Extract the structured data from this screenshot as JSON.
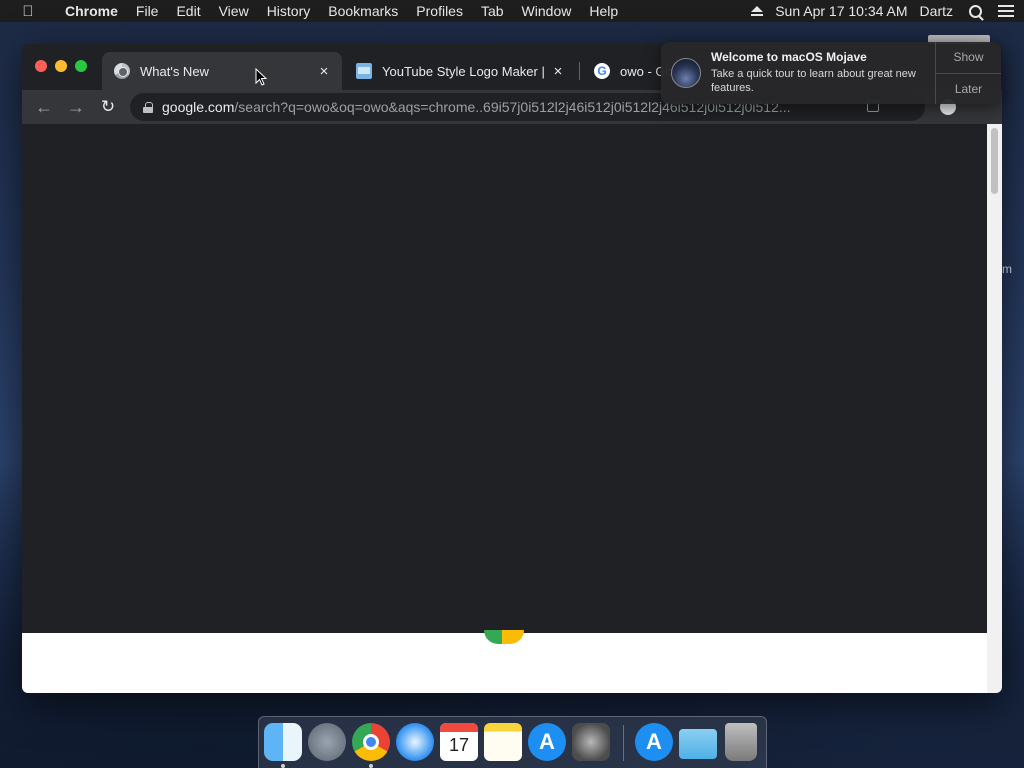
{
  "menubar": {
    "app_name": "Chrome",
    "items": [
      "File",
      "Edit",
      "View",
      "History",
      "Bookmarks",
      "Profiles",
      "Tab",
      "Window",
      "Help"
    ],
    "datetime": "Sun Apr 17  10:34 AM",
    "user": "Dartz"
  },
  "browser": {
    "tabs": [
      {
        "title": "What's New",
        "icon": "chrome-icon",
        "active": true
      },
      {
        "title": "YouTube Style Logo Maker | Go",
        "icon": "logo-maker-icon",
        "active": false
      },
      {
        "title": "owo - Go",
        "icon": "google-icon",
        "active": false
      }
    ],
    "tab_close_glyph": "×",
    "address": {
      "domain": "google.com",
      "path": "/search?q=owo&oq=owo&aqs=chrome..69i57j0i512l2j46i512j0i512l2j46i512j0i512j0i512..."
    },
    "nav_glyphs": {
      "back": "←",
      "forward": "→",
      "reload": "↻"
    }
  },
  "notification": {
    "title": "Welcome to macOS Mojave",
    "body": "Take a quick tour to learn about great new features.",
    "actions": [
      "Show",
      "Later"
    ]
  },
  "desktop": {
    "partial_label": "m"
  },
  "dock": {
    "items": [
      "finder-icon",
      "launchpad-icon",
      "chrome-icon",
      "safari-icon",
      "calendar-icon",
      "notes-icon",
      "app-store-icon",
      "system-preferences-icon",
      "app-store-icon",
      "downloads-folder-icon",
      "trash-icon"
    ],
    "calendar_day": "17"
  }
}
